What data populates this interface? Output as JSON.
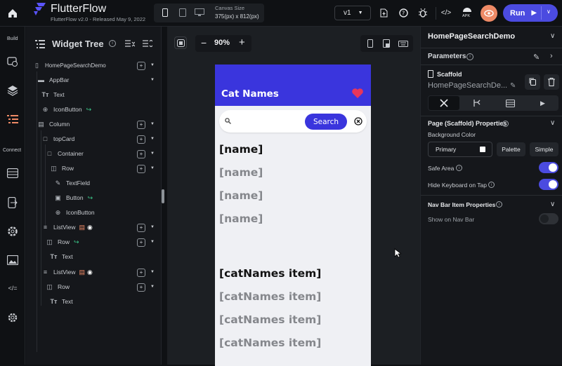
{
  "app": {
    "name": "FlutterFlow",
    "version": "FlutterFlow v2.0 - Released May 9, 2022"
  },
  "topbar": {
    "canvas_size_label": "Canvas Size",
    "canvas_size_value": "375(px) x 812(px)",
    "version_select": "v1",
    "apk_label": "APK",
    "run_label": "Run"
  },
  "rail": {
    "build_label": "Build",
    "connect_label": "Connect"
  },
  "widget_tree": {
    "title": "Widget Tree",
    "items": [
      {
        "label": "HomePageSearchDemo"
      },
      {
        "label": "AppBar"
      },
      {
        "label": "Text"
      },
      {
        "label": "IconButton"
      },
      {
        "label": "Column"
      },
      {
        "label": "topCard"
      },
      {
        "label": "Container"
      },
      {
        "label": "Row"
      },
      {
        "label": "TextField"
      },
      {
        "label": "Button"
      },
      {
        "label": "IconButton"
      },
      {
        "label": "ListView"
      },
      {
        "label": "Row"
      },
      {
        "label": "Text"
      },
      {
        "label": "ListView"
      },
      {
        "label": "Row"
      },
      {
        "label": "Text"
      }
    ]
  },
  "canvas": {
    "zoom": "90%"
  },
  "phone": {
    "appbar_title": "Cat Names",
    "search_button": "Search",
    "list1": [
      "[name]",
      "[name]",
      "[name]",
      "[name]"
    ],
    "list2": [
      "[catNames item]",
      "[catNames item]",
      "[catNames item]",
      "[catNames item]"
    ],
    "colors": {
      "primary": "#3a35dd",
      "heart": "#e8365a"
    }
  },
  "props": {
    "page_name": "HomePageSearchDemo",
    "parameters_label": "Parameters",
    "widget_type": "Scaffold",
    "widget_name": "HomePageSearchDe...",
    "scaffold_props_title": "Page (Scaffold) Properties",
    "bg_color_label": "Background Color",
    "bg_color_value": "Primary",
    "palette_btn": "Palette",
    "simple_btn": "Simple",
    "safe_area_label": "Safe Area",
    "safe_area": true,
    "hide_kb_label": "Hide Keyboard on Tap",
    "hide_kb": true,
    "nav_section_title": "Nav Bar Item Properties",
    "show_nav_label": "Show on Nav Bar",
    "show_nav": false,
    "accent": "#4b4be0"
  }
}
